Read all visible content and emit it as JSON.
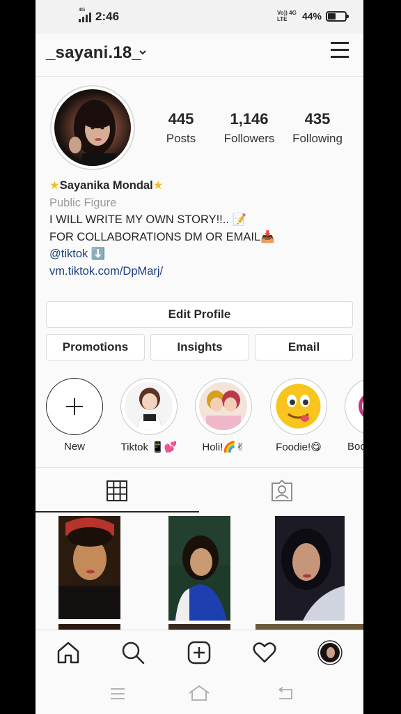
{
  "status_bar": {
    "network_small": "4G",
    "time": "2:46",
    "volte": "Vo)) 4G LTE",
    "battery_percent": "44%",
    "battery_level": 0.44
  },
  "header": {
    "username": "_sayani.18_"
  },
  "profile": {
    "stats": [
      {
        "value": "445",
        "label": "Posts"
      },
      {
        "value": "1,146",
        "label": "Followers"
      },
      {
        "value": "435",
        "label": "Following"
      }
    ],
    "name": "Sayanika Mondal",
    "category": "Public Figure",
    "bio_line1": "I WILL WRITE MY OWN STORY!!..",
    "bio_line2": "FOR COLLABORATIONS DM OR EMAIL",
    "mention": "@tiktok",
    "website": "vm.tiktok.com/DpMarj/"
  },
  "buttons": {
    "edit_profile": "Edit Profile",
    "promotions": "Promotions",
    "insights": "Insights",
    "email": "Email"
  },
  "highlights": [
    {
      "label": "New"
    },
    {
      "label": "Tiktok 📱💕"
    },
    {
      "label": "Holi!🌈✌"
    },
    {
      "label": "Foodie!😋"
    },
    {
      "label": "Boo"
    }
  ],
  "icons": {
    "menu": "hamburger-icon",
    "grid": "grid-icon",
    "tagged": "tagged-icon",
    "home": "home-icon",
    "search": "search-icon",
    "add": "add-icon",
    "activity": "heart-icon",
    "profile": "profile-avatar"
  },
  "colors": {
    "link": "#1b3d7d",
    "category": "#999999",
    "text": "#262626"
  }
}
